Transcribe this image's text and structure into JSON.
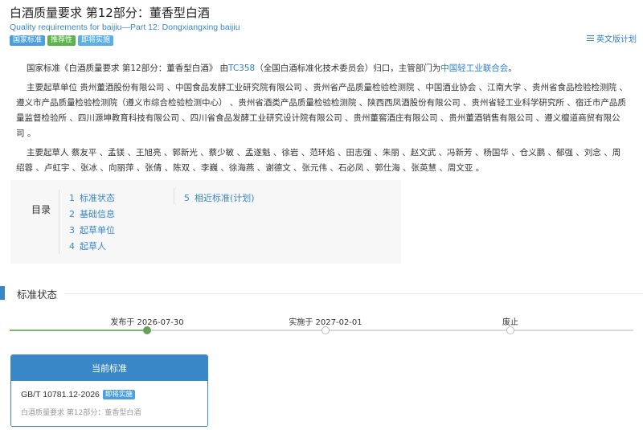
{
  "header": {
    "title": "白酒质量要求 第12部分：董香型白酒",
    "subtitle": "Quality requirements for baijiu—Part 12: Dongxiangxing baijiu",
    "tags": [
      {
        "label": "国家标准",
        "color": "#4a9fe0"
      },
      {
        "label": "推荐性",
        "color": "#5ab44a"
      },
      {
        "label": "即将实施",
        "color": "#5ab0e6"
      }
    ],
    "english_plan_link": "英文版计划",
    "english_plan_icon": "list-icon"
  },
  "intro": {
    "p1_pre": "国家标准《白酒质量要求 第12部分：董香型白酒》 由",
    "p1_tc": "TC358",
    "p1_mid": "（全国白酒标准化技术委员会）归口，主管部门为",
    "p1_dept": "中国轻工业联合会",
    "p1_end": "。",
    "p2": "主要起草单位 贵州董酒股份有限公司 、中国食品发酵工业研究院有限公司 、贵州省产品质量检验检测院 、中国酒业协会 、江南大学 、贵州省食品检验检测院 、遵义市产品质量检验检测院（遵义市综合检验检测中心） 、贵州省酒类产品质量检验检测院 、陕西西凤酒股份有限公司 、贵州省轻工业科学研究所 、宿迁市产品质量监督检验所 、四川源坤教育科技有限公司 、四川省食品发酵工业研究设计院有限公司 、贵州董窖酒庄有限公司 、贵州董酒销售有限公司 、遵义檀道商贸有限公司 。",
    "p3": "主要起草人 蔡友平 、孟镁 、王旭亮 、郭新光 、蔡少敏 、孟遂魁 、徐岩 、范环焰 、田志强 、朱丽 、赵文武 、冯新芳 、杨国华 、仓义鹏 、郁强 、刘念 、周绍蓉 、卢虹宇 、张冰 、向丽萍 、张倩 、陈双 、李巍 、徐海燕 、谢德文 、张元伟 、石必凤 、郭仕海 、张英慧 、周文亚 。"
  },
  "toc": {
    "label": "目录",
    "col1": [
      {
        "num": "1",
        "label": "标准状态"
      },
      {
        "num": "2",
        "label": "基础信息"
      },
      {
        "num": "3",
        "label": "起草单位"
      },
      {
        "num": "4",
        "label": "起草人"
      }
    ],
    "col2": [
      {
        "num": "5",
        "label": "相近标准(计划)"
      }
    ]
  },
  "status_section": {
    "title": "标准状态",
    "timeline": [
      {
        "label": "发布于 2026-07-30",
        "done": true
      },
      {
        "label": "实施于 2027-02-01",
        "done": false
      },
      {
        "label": "废止",
        "done": false
      }
    ],
    "progress_stage": 1,
    "accent_color": "#3a87c8",
    "progress_color": "#7db86a"
  },
  "current_card": {
    "header": "当前标准",
    "code": "GB/T 10781.12-2026",
    "badge": "即将实施",
    "name": "白酒质量要求 第12部分：董香型白酒"
  }
}
